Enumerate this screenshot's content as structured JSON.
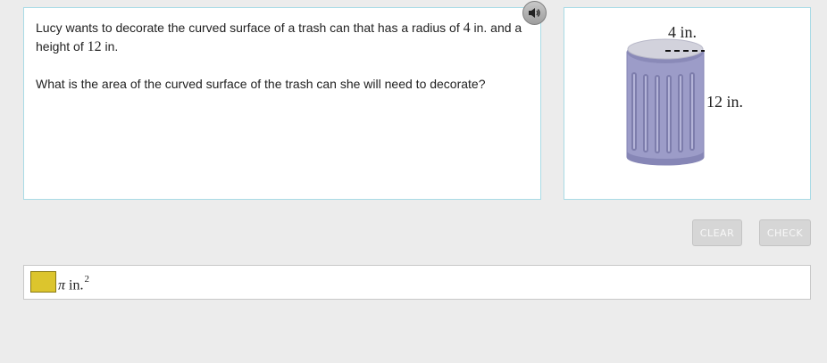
{
  "question": {
    "line1_before_radius": "Lucy wants to decorate the curved surface of a trash can that has a radius of ",
    "radius_value": "4",
    "line1_after_radius": " in. and a height of ",
    "height_value": "12",
    "line1_end": " in.",
    "line2": "What is the area of the curved surface of the trash can she will need to decorate?"
  },
  "figure": {
    "radius_label": "4 in.",
    "height_label": "12 in.",
    "can_color": "#9c9cc8",
    "can_dark_color": "#7a7aa8",
    "lid_color": "#d2d2dc"
  },
  "buttons": {
    "clear": "CLEAR",
    "check": "CHECK"
  },
  "answer": {
    "value": "",
    "pi_symbol": "π",
    "unit": "in.",
    "exponent": "2",
    "input_color": "#dcc52d"
  },
  "icons": {
    "speaker": "speaker-icon"
  }
}
